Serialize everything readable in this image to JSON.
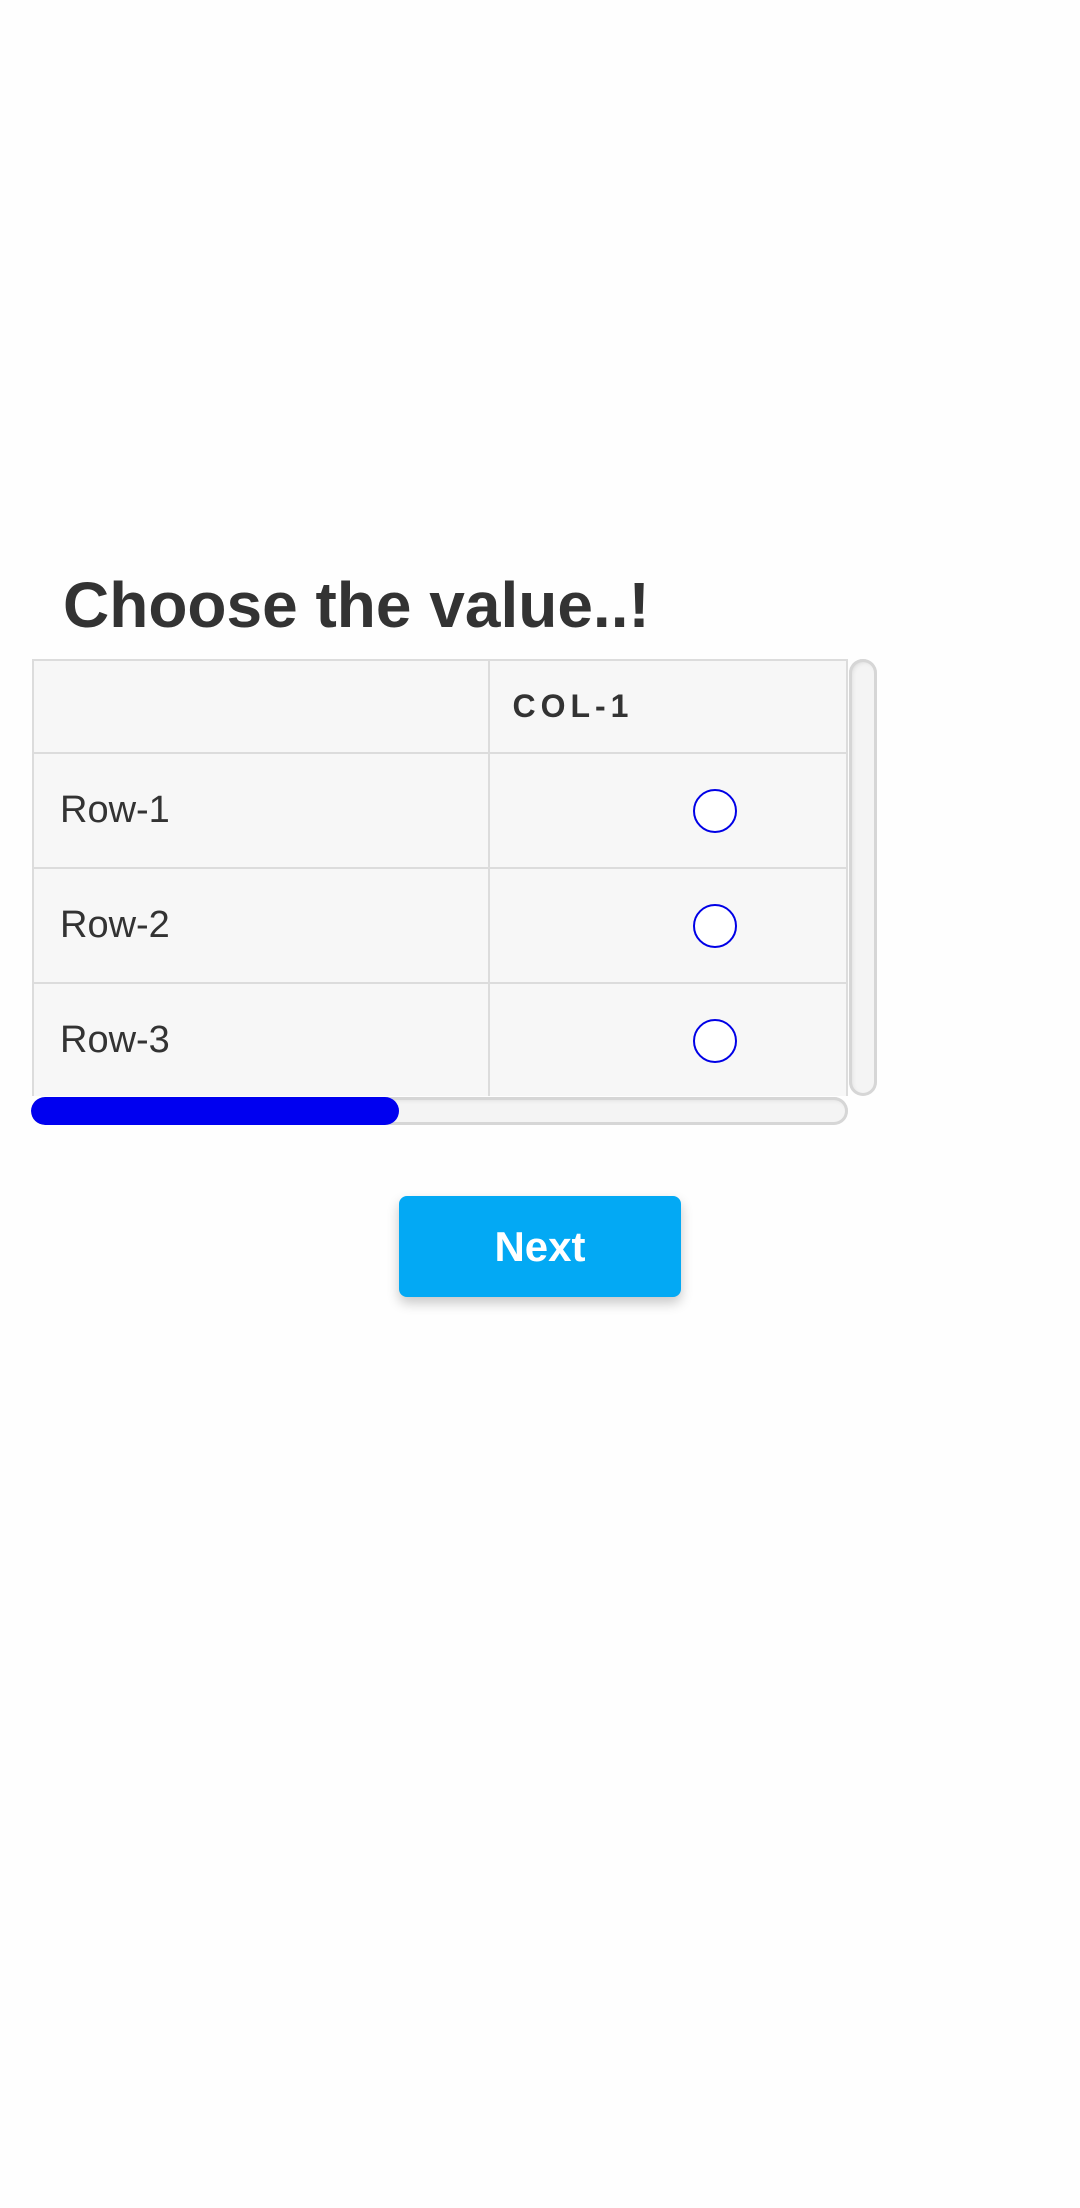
{
  "question": {
    "title": "Choose the value..!"
  },
  "matrix": {
    "corner_label": "",
    "columns": [
      "COL-1"
    ],
    "rows": [
      {
        "label": "Row-1",
        "selected": false
      },
      {
        "label": "Row-2",
        "selected": false
      },
      {
        "label": "Row-3",
        "selected": false
      }
    ],
    "horizontal_scroll_position": 0.45
  },
  "actions": {
    "next_label": "Next"
  },
  "colors": {
    "radio_border": "#0000e6",
    "scroll_thumb": "#0000f0",
    "next_button_bg": "#03a9f4",
    "title_text": "#333333"
  }
}
